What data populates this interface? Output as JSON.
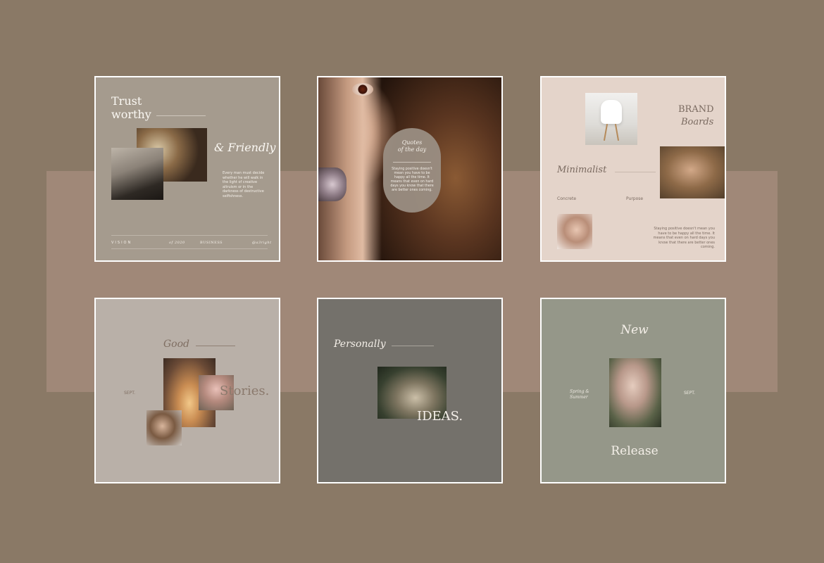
{
  "cards": [
    {
      "title_line1": "Trust",
      "title_line2": "worthy",
      "subtitle": "& Friendly",
      "body": "Every man must decide whether he will walk in the light of creative altruism or in the darkness of destructive selfishness.",
      "footer": [
        "VISION",
        "of 2020",
        "BUSINESS",
        "@a3right"
      ]
    },
    {
      "quote_title_line1": "Quotes",
      "quote_title_line2": "of the day",
      "quote_body": "Staying positive doesn't mean you have to be happy all the time. It means that even on hard days you know that there are better ones coming."
    },
    {
      "title_line1": "BRAND",
      "title_line2": "Boards",
      "subtitle": "Minimalist",
      "label_left": "Concrete",
      "label_right": "Purpose",
      "body": "Staying positive doesn't mean you have to be happy all the time. It means that even on hard days you know that there are better ones coming."
    },
    {
      "title": "Good",
      "word": "Stories.",
      "side_label": "SEPT."
    },
    {
      "title": "Personally",
      "word": "IDEAS."
    },
    {
      "title": "New",
      "side_left_line1": "Spring &",
      "side_left_line2": "Summer",
      "side_right": "SEPT.",
      "word": "Release"
    }
  ],
  "colors": {
    "background": "#8a7966",
    "band": "#a08878",
    "card1": "#a59b8e",
    "card3": "#e4d4ca",
    "card4": "#b9b0a8",
    "card5": "#74716b",
    "card6": "#959789"
  }
}
